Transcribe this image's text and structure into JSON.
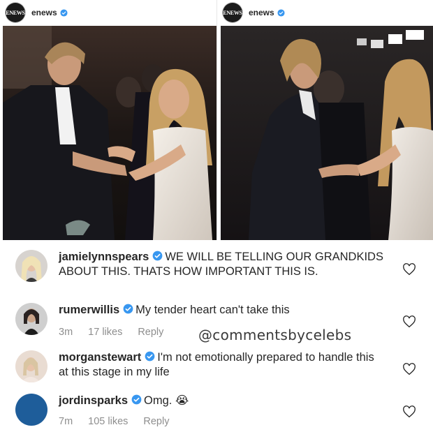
{
  "posts": [
    {
      "account": "enews",
      "logo_text": "ENEWS"
    },
    {
      "account": "enews",
      "logo_text": "ENEWS"
    }
  ],
  "comments": [
    {
      "username": "jamielynnspears",
      "text": "WE WILL BE TELLING OUR GRANDKIDS ABOUT THIS. THATS HOW IMPORTANT THIS IS."
    },
    {
      "username": "rumerwillis",
      "text": "My tender heart can't take this",
      "time": "3m",
      "likes": "17 likes",
      "reply": "Reply"
    },
    {
      "username": "morganstewart",
      "text": "I'm not emotionally prepared to handle this at this stage in my life"
    },
    {
      "username": "jordinsparks",
      "text": "Omg. 😭",
      "time": "7m",
      "likes": "105 likes",
      "reply": "Reply"
    }
  ],
  "watermark": "@commentsbycelebs",
  "colors": {
    "verified": "#3897f0",
    "meta": "#8e8e8e",
    "avatar_jordin": "#1e5d9a"
  }
}
